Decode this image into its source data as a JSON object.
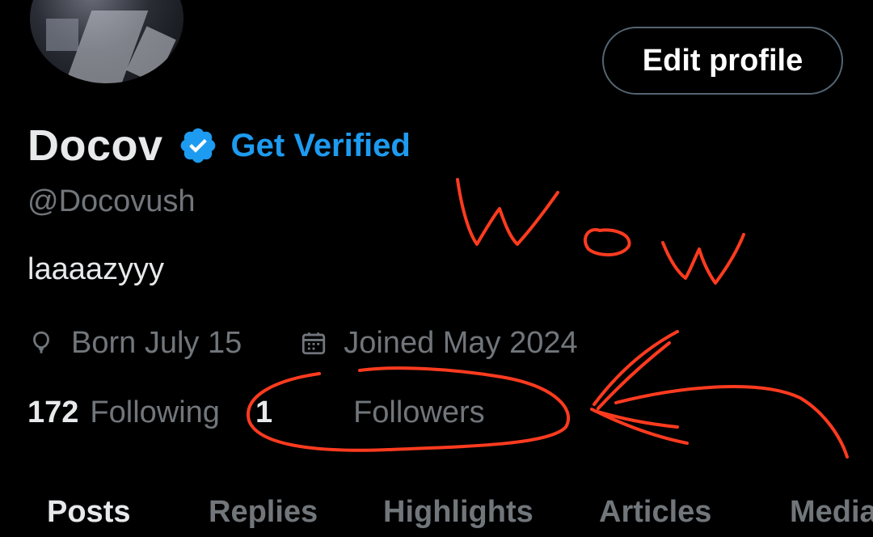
{
  "profile": {
    "display_name": "Docov",
    "verify_label": "Get Verified",
    "handle": "@Docovush",
    "bio": "laaaazyyy",
    "born": "Born July 15",
    "joined": "Joined May 2024",
    "following_count": "172",
    "following_label": "Following",
    "followers_count": "1",
    "followers_label": "Followers"
  },
  "actions": {
    "edit_profile_label": "Edit profile"
  },
  "tabs": [
    {
      "label": "Posts",
      "active": true
    },
    {
      "label": "Replies",
      "active": false
    },
    {
      "label": "Highlights",
      "active": false
    },
    {
      "label": "Articles",
      "active": false
    },
    {
      "label": "Media",
      "active": false
    }
  ],
  "annotation": {
    "handwritten_text": "Wow",
    "ink_color": "#ff3b1f"
  },
  "colors": {
    "background": "#000000",
    "primary_text": "#e7e9ea",
    "secondary_text": "#71767b",
    "accent_blue": "#1d9bf0",
    "button_border": "#536471"
  }
}
